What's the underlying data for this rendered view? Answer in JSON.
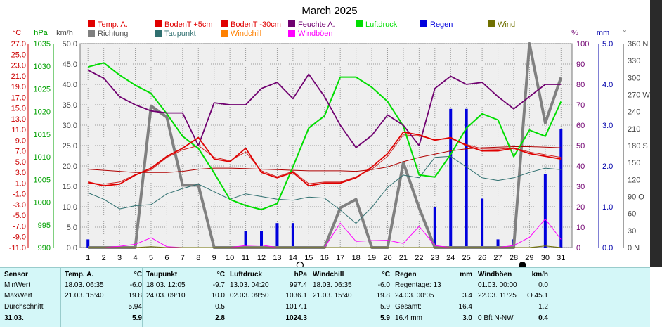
{
  "title": "March 2025",
  "units": {
    "temp": "°C",
    "hpa": "hPa",
    "kmh": "km/h",
    "pct": "%",
    "mm": "mm",
    "deg": "°"
  },
  "legend": [
    {
      "label": "Temp. A.",
      "color": "#e00000"
    },
    {
      "label": "BodenT +5cm",
      "color": "#e00000"
    },
    {
      "label": "BodenT -30cm",
      "color": "#e00000"
    },
    {
      "label": "Feuchte A.",
      "color": "#700070"
    },
    {
      "label": "Luftdruck",
      "color": "#00dd00"
    },
    {
      "label": "Regen",
      "color": "#0000dd"
    },
    {
      "label": "Wind",
      "color": "#707000"
    },
    {
      "label": "Richtung",
      "color": "#808080"
    },
    {
      "label": "Taupunkt",
      "color": "#307070"
    },
    {
      "label": "Windchill",
      "color": "#ff8000"
    },
    {
      "label": "Windböen",
      "color": "#ff00ff"
    }
  ],
  "chart_data": {
    "type": "line",
    "title": "March 2025",
    "x": [
      1,
      2,
      3,
      4,
      5,
      6,
      7,
      8,
      9,
      10,
      11,
      12,
      13,
      14,
      15,
      16,
      17,
      18,
      19,
      20,
      21,
      22,
      23,
      24,
      25,
      26,
      27,
      28,
      29,
      30,
      31
    ],
    "axes": {
      "temp": {
        "label": "°C",
        "ticks": [
          "27.0",
          "25.0",
          "23.0",
          "21.0",
          "19.0",
          "17.0",
          "15.0",
          "13.0",
          "11.0",
          "9.0",
          "7.0",
          "5.0",
          "3.0",
          "1.0",
          "-1.0",
          "-3.0",
          "-5.0",
          "-7.0",
          "-9.0",
          "-11.0"
        ],
        "range": [
          -11,
          27
        ]
      },
      "pressure": {
        "label": "hPa",
        "ticks": [
          "1035",
          "1030",
          "1025",
          "1020",
          "1015",
          "1010",
          "1005",
          "1000",
          "995",
          "990"
        ],
        "range": [
          990,
          1040
        ]
      },
      "wind": {
        "label": "km/h",
        "ticks": [
          "50.0",
          "45.0",
          "40.0",
          "35.0",
          "30.0",
          "25.0",
          "20.0",
          "15.0",
          "10.0",
          "5.0",
          "0.0"
        ],
        "range": [
          0,
          50
        ]
      },
      "humidity": {
        "label": "%",
        "ticks": [
          "100",
          "90",
          "80",
          "70",
          "60",
          "50",
          "40",
          "30",
          "20",
          "10",
          "0"
        ],
        "range": [
          0,
          100
        ]
      },
      "rain": {
        "label": "mm",
        "ticks": [
          "5.0",
          "4.0",
          "3.0",
          "2.0",
          "1.0",
          "0.0"
        ],
        "range": [
          0,
          5
        ]
      },
      "direction": {
        "label": "°",
        "ticks": [
          "360 N",
          "330",
          "300",
          "270 W",
          "240",
          "210",
          "180 S",
          "150",
          "120",
          "90 O",
          "60",
          "30",
          "0 N"
        ],
        "range": [
          0,
          360
        ]
      }
    },
    "series": [
      {
        "name": "Temp. A.",
        "axis": "temp",
        "values": [
          1.2,
          0.5,
          0.8,
          2.5,
          3.8,
          6.0,
          7.5,
          9.5,
          5.5,
          5.0,
          7.5,
          3.0,
          2.0,
          3.0,
          0.5,
          1.0,
          1.0,
          2.0,
          4.0,
          6.5,
          10.5,
          10.0,
          9.0,
          9.5,
          8.0,
          7.0,
          7.0,
          7.5,
          6.5,
          6.0,
          5.5
        ]
      },
      {
        "name": "BodenT +5cm",
        "axis": "temp",
        "values": [
          1.0,
          0.8,
          1.2,
          2.6,
          3.5,
          5.8,
          7.2,
          8.0,
          5.8,
          5.2,
          6.8,
          3.3,
          2.2,
          3.2,
          0.9,
          1.2,
          1.2,
          2.2,
          3.6,
          6.0,
          10.0,
          9.8,
          9.1,
          9.3,
          8.2,
          7.4,
          7.3,
          7.6,
          6.8,
          6.3,
          5.8
        ]
      },
      {
        "name": "BodenT -30cm",
        "axis": "temp",
        "values": [
          3.6,
          3.4,
          3.2,
          3.0,
          3.0,
          3.0,
          3.2,
          3.6,
          3.8,
          3.8,
          3.7,
          3.6,
          3.5,
          3.4,
          3.3,
          3.3,
          3.3,
          3.2,
          3.5,
          4.0,
          5.0,
          5.8,
          6.4,
          7.0,
          7.4,
          7.6,
          7.7,
          7.8,
          7.8,
          7.7,
          7.6
        ]
      },
      {
        "name": "Taupunkt",
        "axis": "temp",
        "values": [
          -0.8,
          -2.0,
          -3.8,
          -3.2,
          -3.0,
          -1.0,
          0.0,
          0.8,
          -0.6,
          -2.0,
          -1.0,
          -1.5,
          -2.0,
          -2.2,
          -1.6,
          -1.8,
          -4.0,
          -6.5,
          -3.5,
          0.2,
          2.5,
          2.0,
          5.8,
          6.0,
          4.0,
          2.0,
          1.5,
          2.0,
          3.0,
          3.8,
          3.5
        ]
      },
      {
        "name": "Luftdruck",
        "axis": "pressure",
        "values": [
          1034.3,
          1035.3,
          1032.3,
          1029.8,
          1027.8,
          1022.8,
          1017.3,
          1014.3,
          1008.3,
          1001.8,
          1000.3,
          999.3,
          1000.8,
          1009.8,
          1019.3,
          1022.3,
          1031.8,
          1031.8,
          1029.3,
          1025.8,
          1019.8,
          1007.8,
          1007.3,
          1012.8,
          1019.3,
          1022.8,
          1021.3,
          1012.3,
          1018.8,
          1017.3,
          1025.8
        ]
      },
      {
        "name": "Feuchte A.",
        "axis": "humidity",
        "values": [
          87,
          83,
          74,
          70,
          67,
          66,
          66,
          50,
          71,
          70,
          70,
          78,
          81,
          73,
          85,
          74,
          60,
          49,
          55,
          65,
          60,
          50,
          78,
          84,
          80,
          81,
          74,
          68,
          74,
          80,
          80
        ]
      },
      {
        "name": "Richtung",
        "axis": "direction",
        "values": [
          0,
          0,
          0,
          0,
          250,
          230,
          110,
          110,
          0,
          0,
          0,
          0,
          0,
          0,
          0,
          0,
          70,
          85,
          0,
          0,
          150,
          70,
          0,
          0,
          0,
          0,
          0,
          0,
          360,
          220,
          300
        ]
      },
      {
        "name": "Windböen",
        "axis": "wind",
        "values": [
          0.0,
          0.0,
          0.3,
          0.8,
          2.4,
          0.2,
          0.0,
          0.0,
          0.0,
          0.0,
          0.5,
          0.6,
          0.0,
          0.0,
          0.0,
          0.0,
          6.0,
          1.5,
          1.7,
          1.8,
          1.0,
          5.2,
          0.5,
          0.0,
          0.0,
          0.0,
          0.0,
          0.5,
          2.5,
          7.0,
          2.0
        ]
      },
      {
        "name": "Wind",
        "axis": "wind",
        "values": [
          0,
          0,
          0,
          0,
          0.2,
          0,
          0,
          0,
          0,
          0,
          0,
          0,
          0,
          0,
          0,
          0,
          0,
          0,
          0,
          0,
          0,
          0,
          0,
          0,
          0,
          0,
          0,
          0,
          0,
          0.4,
          0
        ]
      },
      {
        "name": "Windchill",
        "axis": "temp",
        "values": []
      }
    ],
    "bars": {
      "name": "Regen",
      "axis": "rain",
      "values": [
        0.2,
        0,
        0,
        0,
        0,
        0,
        0,
        0,
        0,
        0,
        0.4,
        0.4,
        0.6,
        0.6,
        0,
        0,
        0,
        0,
        0,
        0,
        0,
        0,
        1.0,
        3.4,
        3.4,
        1.2,
        0.2,
        0.2,
        0,
        1.8,
        2.9
      ]
    },
    "moon": {
      "full_day": 14,
      "new_day": 29
    }
  },
  "stats": {
    "row_labels": [
      "Sensor",
      "MinWert",
      "MaxWert",
      "Durchschnitt",
      "31.03."
    ],
    "columns": [
      {
        "header": "Temp. A.",
        "unit": "°C",
        "rows": [
          [
            "18.03. 06:35",
            "-6.0"
          ],
          [
            "21.03. 15:40",
            "19.8"
          ],
          [
            "",
            "5.94"
          ],
          [
            "",
            "5.9"
          ]
        ]
      },
      {
        "header": "Taupunkt",
        "unit": "°C",
        "rows": [
          [
            "18.03. 12:05",
            "-9.7"
          ],
          [
            "24.03. 09:10",
            "10.0"
          ],
          [
            "",
            "0.5"
          ],
          [
            "",
            "2.8"
          ]
        ]
      },
      {
        "header": "Luftdruck",
        "unit": "hPa",
        "rows": [
          [
            "13.03. 04:20",
            "997.4"
          ],
          [
            "02.03. 09:50",
            "1036.1"
          ],
          [
            "",
            "1017.1"
          ],
          [
            "",
            "1024.3"
          ]
        ]
      },
      {
        "header": "Windchill",
        "unit": "°C",
        "rows": [
          [
            "18.03. 06:35",
            "-6.0"
          ],
          [
            "21.03. 15:40",
            "19.8"
          ],
          [
            "",
            "5.9"
          ],
          [
            "",
            "5.9"
          ]
        ]
      },
      {
        "header": "Regen",
        "unit": "mm",
        "rows": [
          [
            "Regentage: 13",
            ""
          ],
          [
            "24.03. 00:05",
            "3.4"
          ],
          [
            "Gesamt:",
            "16.4"
          ],
          [
            "16.4 mm",
            "3.0"
          ]
        ]
      },
      {
        "header": "Windböen",
        "unit": "km/h",
        "rows": [
          [
            "01.03. 00:00",
            "0.0"
          ],
          [
            "22.03. 11:25",
            "O 45.1"
          ],
          [
            "",
            "1.2"
          ],
          [
            "0 Bft N-NW",
            "0.4"
          ]
        ]
      }
    ]
  }
}
